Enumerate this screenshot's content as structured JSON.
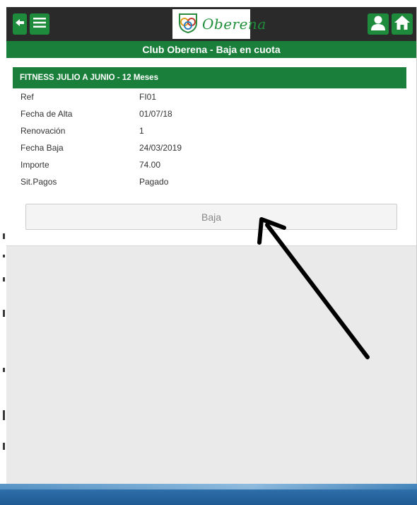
{
  "topbar": {
    "back_icon": "arrow-left-icon",
    "menu_icon": "hamburger-menu-icon",
    "logo_text": "Oberena",
    "user_icon": "user-icon",
    "home_icon": "home-icon"
  },
  "page": {
    "title": "Club Oberena - Baja en cuota"
  },
  "card": {
    "header": "FITNESS JULIO A JUNIO - 12 Meses",
    "fields": [
      {
        "label": "Ref",
        "value": "FI01"
      },
      {
        "label": "Fecha de Alta",
        "value": "01/07/18"
      },
      {
        "label": "Renovación",
        "value": "1"
      },
      {
        "label": "Fecha Baja",
        "value": "24/03/2019"
      },
      {
        "label": "Importe",
        "value": "74.00"
      },
      {
        "label": "Sit.Pagos",
        "value": "Pagado"
      }
    ],
    "button_label": "Baja"
  },
  "colors": {
    "accent": "#1a7f3a",
    "topbar": "#2a2a2a",
    "background": "#eaeaea"
  }
}
